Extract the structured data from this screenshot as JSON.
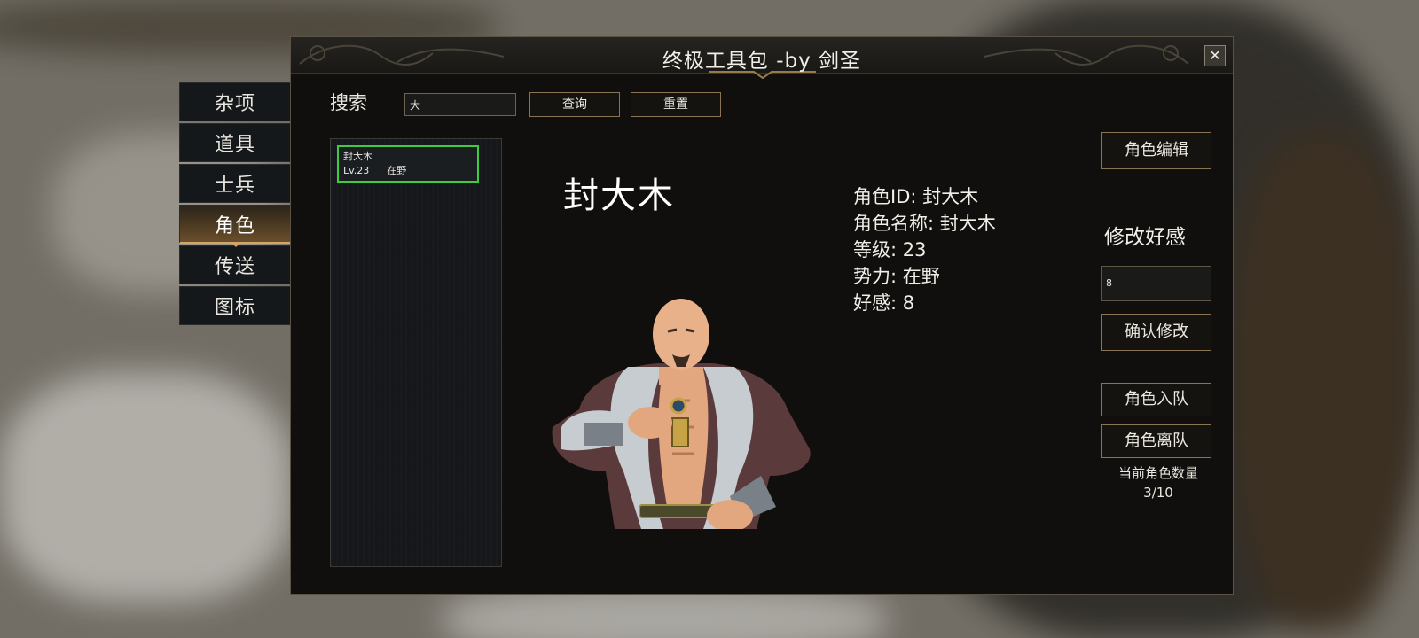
{
  "window": {
    "title": "终极工具包 -by 剑圣",
    "close_symbol": "✕"
  },
  "sidenav": {
    "items": [
      {
        "label": "杂项",
        "active": false
      },
      {
        "label": "道具",
        "active": false
      },
      {
        "label": "士兵",
        "active": false
      },
      {
        "label": "角色",
        "active": true
      },
      {
        "label": "传送",
        "active": false
      },
      {
        "label": "图标",
        "active": false
      }
    ]
  },
  "search": {
    "label": "搜索",
    "value": "大",
    "query_button": "查询",
    "reset_button": "重置"
  },
  "results": [
    {
      "name": "封大木",
      "level": "Lv.23",
      "faction": "在野",
      "selected": true
    }
  ],
  "character": {
    "display_name": "封大木",
    "id_line": "角色ID: 封大木",
    "name_line": "角色名称: 封大木",
    "level_line": "等级: 23",
    "faction_line": "势力: 在野",
    "affinity_line": "好感: 8"
  },
  "actions": {
    "edit_button": "角色编辑",
    "affinity_title": "修改好感",
    "affinity_value": "8",
    "confirm_button": "确认修改",
    "join_button": "角色入队",
    "leave_button": "角色离队",
    "count_label": "当前角色数量",
    "count_value": "3/10"
  },
  "colors": {
    "selection_border": "#3fca3f",
    "button_border": "#8a7552",
    "nav_active": "#d3a566"
  }
}
